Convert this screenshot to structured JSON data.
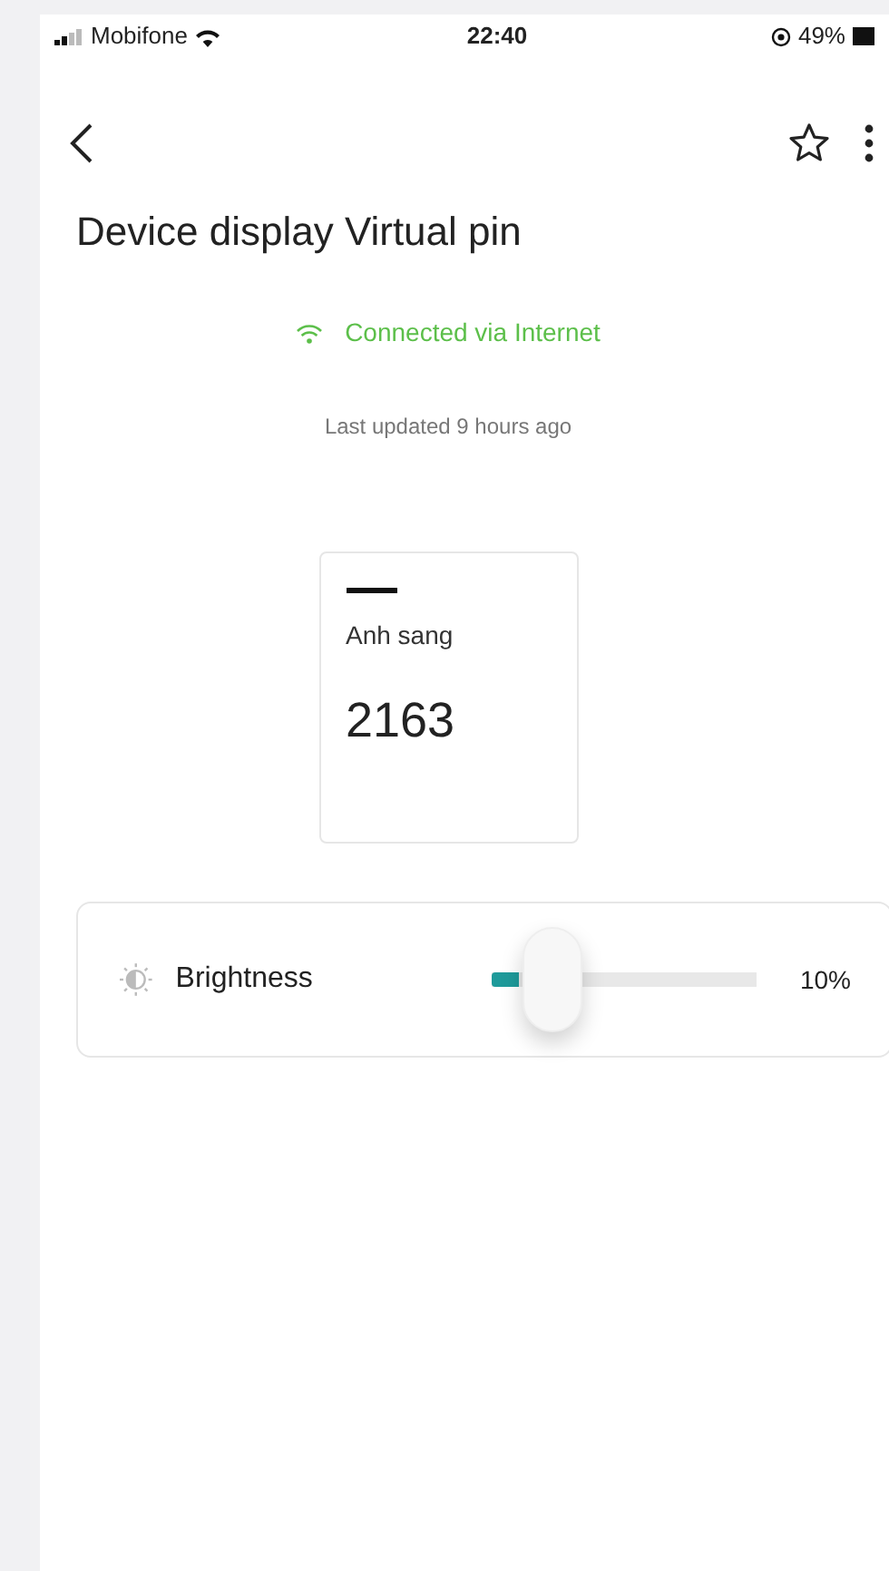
{
  "status_bar": {
    "carrier": "Mobifone",
    "time": "22:40",
    "battery": "49%"
  },
  "title": "Device display Virtual pin",
  "connection": "Connected via Internet",
  "last_updated": "Last updated 9 hours ago",
  "widget": {
    "label": "Anh sang",
    "value": "2163"
  },
  "slider": {
    "label": "Brightness",
    "level": 0.1,
    "reading": "10%"
  }
}
